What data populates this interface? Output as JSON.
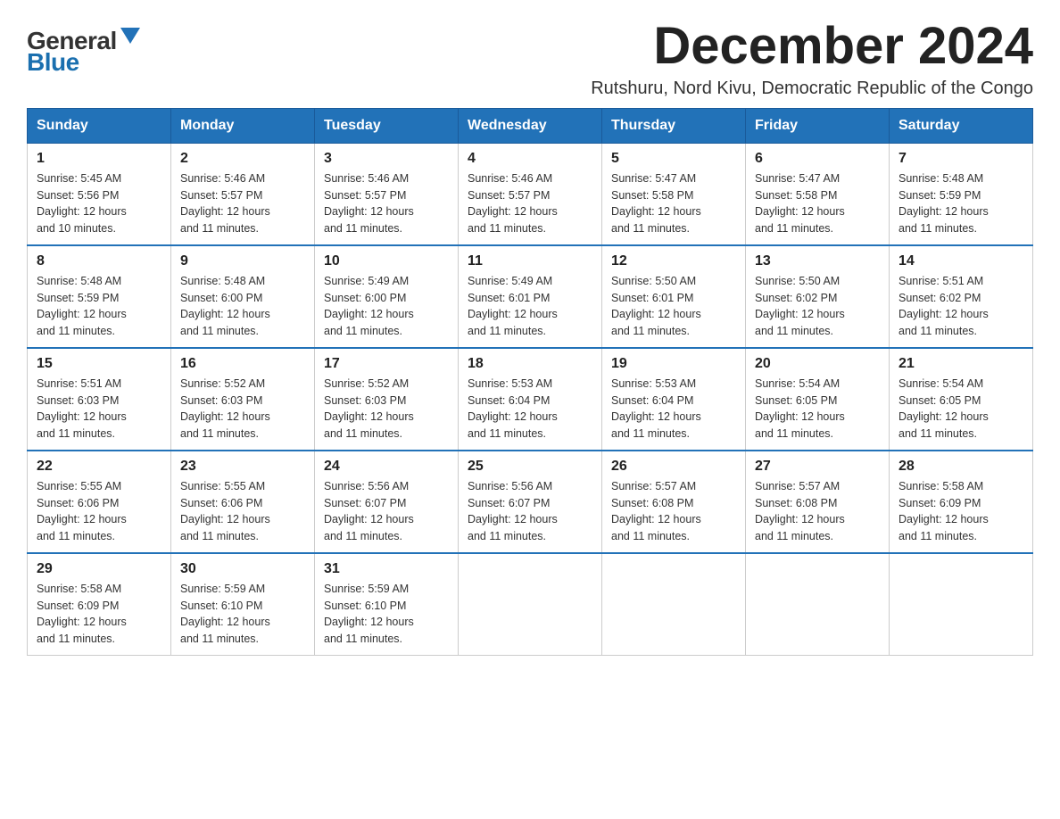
{
  "logo": {
    "general": "General",
    "blue": "Blue"
  },
  "title": "December 2024",
  "location": "Rutshuru, Nord Kivu, Democratic Republic of the Congo",
  "days_of_week": [
    "Sunday",
    "Monday",
    "Tuesday",
    "Wednesday",
    "Thursday",
    "Friday",
    "Saturday"
  ],
  "weeks": [
    [
      {
        "day": "1",
        "sunrise": "5:45 AM",
        "sunset": "5:56 PM",
        "daylight": "12 hours and 10 minutes."
      },
      {
        "day": "2",
        "sunrise": "5:46 AM",
        "sunset": "5:57 PM",
        "daylight": "12 hours and 11 minutes."
      },
      {
        "day": "3",
        "sunrise": "5:46 AM",
        "sunset": "5:57 PM",
        "daylight": "12 hours and 11 minutes."
      },
      {
        "day": "4",
        "sunrise": "5:46 AM",
        "sunset": "5:57 PM",
        "daylight": "12 hours and 11 minutes."
      },
      {
        "day": "5",
        "sunrise": "5:47 AM",
        "sunset": "5:58 PM",
        "daylight": "12 hours and 11 minutes."
      },
      {
        "day": "6",
        "sunrise": "5:47 AM",
        "sunset": "5:58 PM",
        "daylight": "12 hours and 11 minutes."
      },
      {
        "day": "7",
        "sunrise": "5:48 AM",
        "sunset": "5:59 PM",
        "daylight": "12 hours and 11 minutes."
      }
    ],
    [
      {
        "day": "8",
        "sunrise": "5:48 AM",
        "sunset": "5:59 PM",
        "daylight": "12 hours and 11 minutes."
      },
      {
        "day": "9",
        "sunrise": "5:48 AM",
        "sunset": "6:00 PM",
        "daylight": "12 hours and 11 minutes."
      },
      {
        "day": "10",
        "sunrise": "5:49 AM",
        "sunset": "6:00 PM",
        "daylight": "12 hours and 11 minutes."
      },
      {
        "day": "11",
        "sunrise": "5:49 AM",
        "sunset": "6:01 PM",
        "daylight": "12 hours and 11 minutes."
      },
      {
        "day": "12",
        "sunrise": "5:50 AM",
        "sunset": "6:01 PM",
        "daylight": "12 hours and 11 minutes."
      },
      {
        "day": "13",
        "sunrise": "5:50 AM",
        "sunset": "6:02 PM",
        "daylight": "12 hours and 11 minutes."
      },
      {
        "day": "14",
        "sunrise": "5:51 AM",
        "sunset": "6:02 PM",
        "daylight": "12 hours and 11 minutes."
      }
    ],
    [
      {
        "day": "15",
        "sunrise": "5:51 AM",
        "sunset": "6:03 PM",
        "daylight": "12 hours and 11 minutes."
      },
      {
        "day": "16",
        "sunrise": "5:52 AM",
        "sunset": "6:03 PM",
        "daylight": "12 hours and 11 minutes."
      },
      {
        "day": "17",
        "sunrise": "5:52 AM",
        "sunset": "6:03 PM",
        "daylight": "12 hours and 11 minutes."
      },
      {
        "day": "18",
        "sunrise": "5:53 AM",
        "sunset": "6:04 PM",
        "daylight": "12 hours and 11 minutes."
      },
      {
        "day": "19",
        "sunrise": "5:53 AM",
        "sunset": "6:04 PM",
        "daylight": "12 hours and 11 minutes."
      },
      {
        "day": "20",
        "sunrise": "5:54 AM",
        "sunset": "6:05 PM",
        "daylight": "12 hours and 11 minutes."
      },
      {
        "day": "21",
        "sunrise": "5:54 AM",
        "sunset": "6:05 PM",
        "daylight": "12 hours and 11 minutes."
      }
    ],
    [
      {
        "day": "22",
        "sunrise": "5:55 AM",
        "sunset": "6:06 PM",
        "daylight": "12 hours and 11 minutes."
      },
      {
        "day": "23",
        "sunrise": "5:55 AM",
        "sunset": "6:06 PM",
        "daylight": "12 hours and 11 minutes."
      },
      {
        "day": "24",
        "sunrise": "5:56 AM",
        "sunset": "6:07 PM",
        "daylight": "12 hours and 11 minutes."
      },
      {
        "day": "25",
        "sunrise": "5:56 AM",
        "sunset": "6:07 PM",
        "daylight": "12 hours and 11 minutes."
      },
      {
        "day": "26",
        "sunrise": "5:57 AM",
        "sunset": "6:08 PM",
        "daylight": "12 hours and 11 minutes."
      },
      {
        "day": "27",
        "sunrise": "5:57 AM",
        "sunset": "6:08 PM",
        "daylight": "12 hours and 11 minutes."
      },
      {
        "day": "28",
        "sunrise": "5:58 AM",
        "sunset": "6:09 PM",
        "daylight": "12 hours and 11 minutes."
      }
    ],
    [
      {
        "day": "29",
        "sunrise": "5:58 AM",
        "sunset": "6:09 PM",
        "daylight": "12 hours and 11 minutes."
      },
      {
        "day": "30",
        "sunrise": "5:59 AM",
        "sunset": "6:10 PM",
        "daylight": "12 hours and 11 minutes."
      },
      {
        "day": "31",
        "sunrise": "5:59 AM",
        "sunset": "6:10 PM",
        "daylight": "12 hours and 11 minutes."
      },
      null,
      null,
      null,
      null
    ]
  ],
  "labels": {
    "sunrise": "Sunrise:",
    "sunset": "Sunset:",
    "daylight": "Daylight:"
  }
}
